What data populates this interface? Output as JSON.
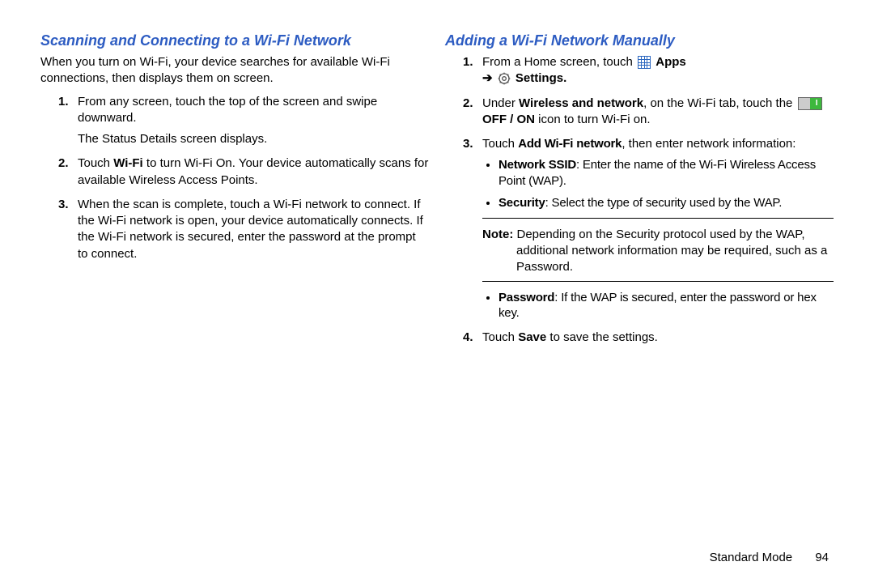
{
  "left": {
    "heading": "Scanning and Connecting to a Wi-Fi Network",
    "intro": "When you turn on Wi-Fi, your device searches for available Wi-Fi connections, then displays them on screen.",
    "steps": {
      "s1a": "From any screen, touch the top of the screen and swipe downward.",
      "s1b": "The Status Details screen displays.",
      "s2a": "Touch ",
      "s2b": "Wi-Fi",
      "s2c": " to turn Wi-Fi On. Your device automatically scans for available Wireless Access Points.",
      "s3": "When the scan is complete, touch a Wi-Fi network to connect. If the Wi-Fi network is open, your device automatically connects. If the Wi-Fi network is secured, enter the password at the prompt to connect."
    }
  },
  "right": {
    "heading": "Adding a Wi-Fi Network Manually",
    "steps": {
      "s1a": "From a Home screen, touch ",
      "s1_apps": "Apps",
      "s1_arrow": "➔",
      "s1_settings": "Settings.",
      "s2a": "Under ",
      "s2b": "Wireless and network",
      "s2c": ", on the Wi-Fi tab, touch the ",
      "s2d": "OFF / ON",
      "s2e": " icon to turn Wi-Fi on.",
      "s3a": "Touch ",
      "s3b": "Add Wi-Fi network",
      "s3c": ", then enter network information:",
      "bullet1a": "Network SSID",
      "bullet1b": ": Enter the name of the Wi-Fi Wireless Access Point (WAP).",
      "bullet2a": "Security",
      "bullet2b": ": Select the type of security used by the WAP.",
      "note_label": "Note:",
      "note_body": " Depending on the Security protocol used by the WAP, additional network information may be required, such as a Password.",
      "bullet3a": "Password",
      "bullet3b": ": If the WAP is secured, enter the password or hex key.",
      "s4a": "Touch ",
      "s4b": "Save",
      "s4c": " to save the settings."
    }
  },
  "footer": {
    "section": "Standard Mode",
    "page": "94"
  }
}
